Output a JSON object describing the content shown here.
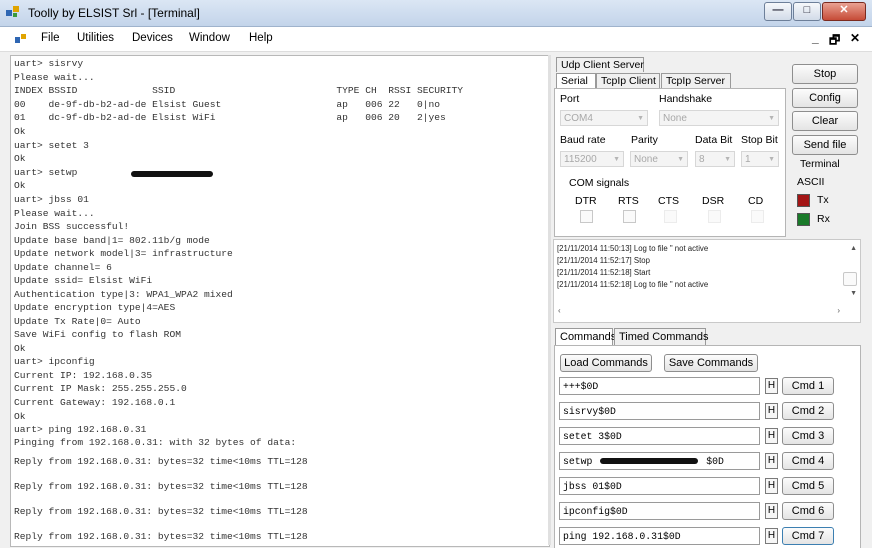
{
  "window": {
    "title": "Toolly by ELSIST Srl - [Terminal]",
    "controls": {
      "minimize": "—",
      "maximize": "□",
      "close": "✕"
    }
  },
  "menu": {
    "items": [
      "File",
      "Utilities",
      "Devices",
      "Window",
      "Help"
    ],
    "mdi_controls": [
      "_",
      "🗗",
      "✕"
    ]
  },
  "terminal": {
    "lines": [
      "uart> sisrvy",
      "Please wait...",
      "INDEX BSSID             SSID                            TYPE CH  RSSI SECURITY",
      "00    de-9f-db-b2-ad-de Elsist Guest                    ap   006 22   0|no",
      "01    dc-9f-db-b2-ad-de Elsist WiFi                     ap   006 20   2|yes",
      "Ok",
      "uart> setet 3",
      "Ok",
      "uart> setwp",
      "Ok",
      "uart> jbss 01",
      "Please wait...",
      "Join BSS successful!",
      "Update base band|1= 802.11b/g mode",
      "Update network model|3= infrastructure",
      "Update channel= 6",
      "Update ssid= Elsist WiFi",
      "Authentication type|3: WPA1_WPA2 mixed",
      "Update encryption type|4=AES",
      "Update Tx Rate|0= Auto",
      "Save WiFi config to flash ROM",
      "Ok",
      "uart> ipconfig",
      "Current IP: 192.168.0.35",
      "Current IP Mask: 255.255.255.0",
      "Current Gateway: 192.168.0.1",
      "Ok",
      "uart> ping 192.168.0.31",
      "Pinging from 192.168.0.31: with 32 bytes of data:",
      "Reply from 192.168.0.31: bytes=32 time<10ms TTL=128",
      "Reply from 192.168.0.31: bytes=32 time<10ms TTL=128",
      "Reply from 192.168.0.31: bytes=32 time<10ms TTL=128",
      "Reply from 192.168.0.31: bytes=32 time<10ms TTL=128"
    ]
  },
  "connection": {
    "top_tabs": [
      "Udp Client Server"
    ],
    "tabs": [
      "Serial",
      "TcpIp Client",
      "TcpIp Server"
    ],
    "active_tab": "Serial",
    "serial": {
      "port_label": "Port",
      "port_value": "COM4",
      "handshake_label": "Handshake",
      "handshake_value": "None",
      "baud_label": "Baud rate",
      "baud_value": "115200",
      "parity_label": "Parity",
      "parity_value": "None",
      "databit_label": "Data Bit",
      "databit_value": "8",
      "stopbit_label": "Stop Bit",
      "stopbit_value": "1",
      "com_signals_label": "COM signals",
      "signals": [
        "DTR",
        "RTS",
        "CTS",
        "DSR",
        "CD"
      ]
    }
  },
  "buttons": {
    "stop": "Stop",
    "config": "Config",
    "clear": "Clear",
    "send_file": "Send file"
  },
  "terminal_mode": {
    "label": "Terminal",
    "ascii": "ASCII",
    "tx": "Tx",
    "rx": "Rx",
    "tx_color": "#a31515",
    "rx_color": "#1a7a2a"
  },
  "log": {
    "lines": [
      "[21/11/2014 11:50:13] Log to file \" not active",
      "[21/11/2014 11:52:17] Stop",
      "[21/11/2014 11:52:18] Start",
      "[21/11/2014 11:52:18] Log to file \" not active"
    ]
  },
  "commands": {
    "tabs": [
      "Commands",
      "Timed Commands"
    ],
    "load": "Load Commands",
    "save": "Save Commands",
    "hex_label": "H",
    "rows": [
      {
        "text": "+++$0D",
        "button": "Cmd 1"
      },
      {
        "text": "sisrvy$0D",
        "button": "Cmd 2"
      },
      {
        "text": "setet 3$0D",
        "button": "Cmd 3"
      },
      {
        "text": "setwp",
        "suffix": "$0D",
        "button": "Cmd 4"
      },
      {
        "text": "jbss 01$0D",
        "button": "Cmd 5"
      },
      {
        "text": "ipconfig$0D",
        "button": "Cmd 6"
      },
      {
        "text": "ping 192.168.0.31$0D",
        "button": "Cmd 7"
      }
    ]
  }
}
